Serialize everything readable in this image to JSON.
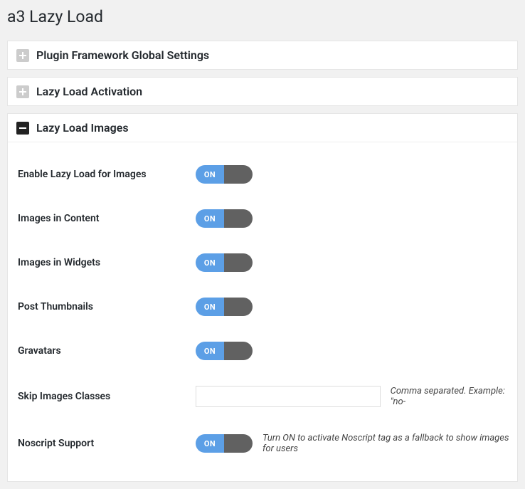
{
  "page_title": "a3 Lazy Load",
  "panels": {
    "global": {
      "title": "Plugin Framework Global Settings"
    },
    "activation": {
      "title": "Lazy Load Activation"
    },
    "images": {
      "title": "Lazy Load Images"
    }
  },
  "settings": {
    "enable_images": {
      "label": "Enable Lazy Load for Images",
      "toggle_label": "ON"
    },
    "images_content": {
      "label": "Images in Content",
      "toggle_label": "ON"
    },
    "images_widgets": {
      "label": "Images in Widgets",
      "toggle_label": "ON"
    },
    "post_thumbnails": {
      "label": "Post Thumbnails",
      "toggle_label": "ON"
    },
    "gravatars": {
      "label": "Gravatars",
      "toggle_label": "ON"
    },
    "skip_classes": {
      "label": "Skip Images Classes",
      "value": "",
      "helper": "Comma separated. Example: \"no-"
    },
    "noscript": {
      "label": "Noscript Support",
      "toggle_label": "ON",
      "helper": "Turn ON to activate Noscript tag as a fallback to show images for users"
    }
  }
}
